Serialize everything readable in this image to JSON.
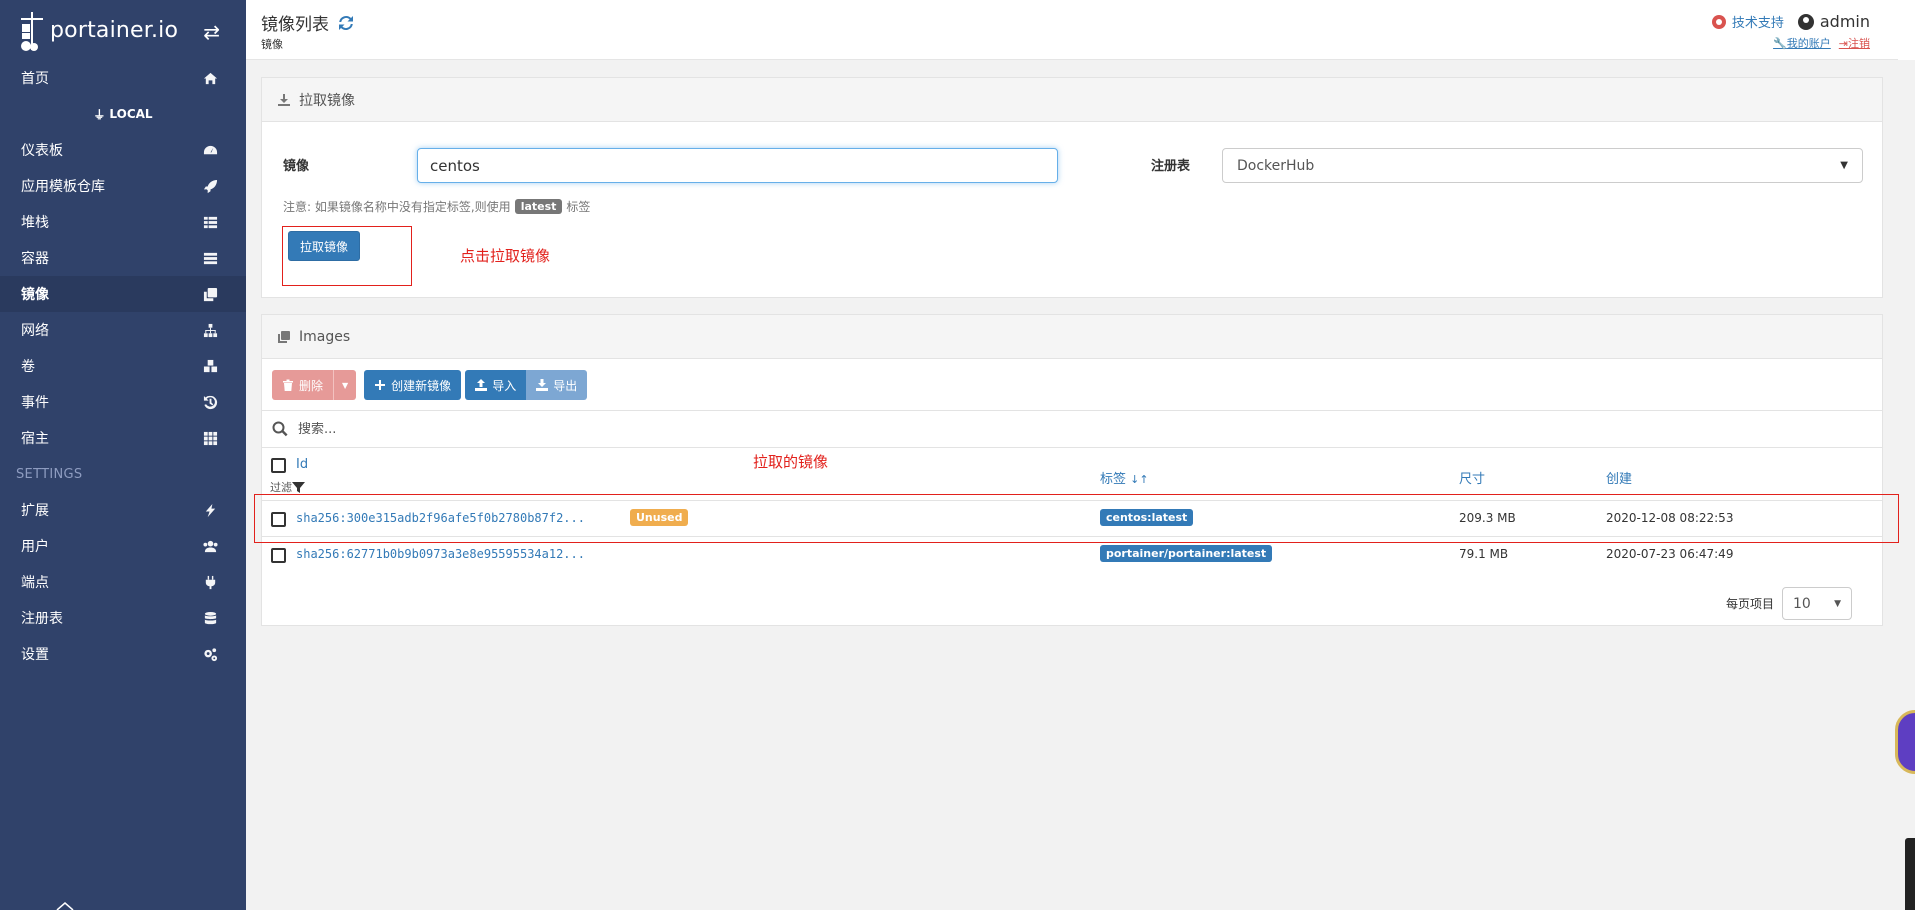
{
  "sidebar": {
    "brand": "portainer.io",
    "home": "首页",
    "env": "LOCAL",
    "items": [
      {
        "label": "仪表板"
      },
      {
        "label": "应用模板仓库"
      },
      {
        "label": "堆栈"
      },
      {
        "label": "容器"
      },
      {
        "label": "镜像"
      },
      {
        "label": "网络"
      },
      {
        "label": "卷"
      },
      {
        "label": "事件"
      },
      {
        "label": "宿主"
      }
    ],
    "settings_title": "SETTINGS",
    "settings_items": [
      {
        "label": "扩展"
      },
      {
        "label": "用户"
      },
      {
        "label": "端点"
      },
      {
        "label": "注册表"
      },
      {
        "label": "设置"
      }
    ]
  },
  "header": {
    "title": "镜像列表",
    "breadcrumb": "镜像",
    "support": "技术支持",
    "username": "admin",
    "my_account": "我的账户",
    "logout": "注销"
  },
  "pull": {
    "title": "拉取镜像",
    "image_label": "镜像",
    "image_value": "centos",
    "registry_label": "注册表",
    "registry_value": "DockerHub",
    "note_prefix": "注意: 如果镜像名称中没有指定标签,则使用",
    "note_badge": "latest",
    "note_suffix": "标签",
    "pull_button": "拉取镜像",
    "annotation": "点击拉取镜像"
  },
  "images": {
    "title": "Images",
    "toolbar": {
      "delete": "删除",
      "create": "创建新镜像",
      "import": "导入",
      "export": "导出"
    },
    "search_placeholder": "搜索...",
    "columns": {
      "id": "Id",
      "filter": "过滤",
      "tags": "标签",
      "size": "尺寸",
      "created": "创建"
    },
    "annotation": "拉取的镜像",
    "rows": [
      {
        "id": "sha256:300e315adb2f96afe5f0b2780b87f2...",
        "unused": "Unused",
        "tag": "centos:latest",
        "size": "209.3 MB",
        "created": "2020-12-08 08:22:53"
      },
      {
        "id": "sha256:62771b0b9b0973a3e8e95595534a12...",
        "tag": "portainer/portainer:latest",
        "size": "79.1 MB",
        "created": "2020-07-23 06:47:49"
      }
    ],
    "items_per_page_label": "每页项目",
    "items_per_page_value": "10"
  },
  "colors": {
    "sidebar_bg": "#30426a",
    "primary": "#337ab7",
    "danger": "#d9534f",
    "warning": "#f0ad4e",
    "annotation": "#e2211c"
  }
}
